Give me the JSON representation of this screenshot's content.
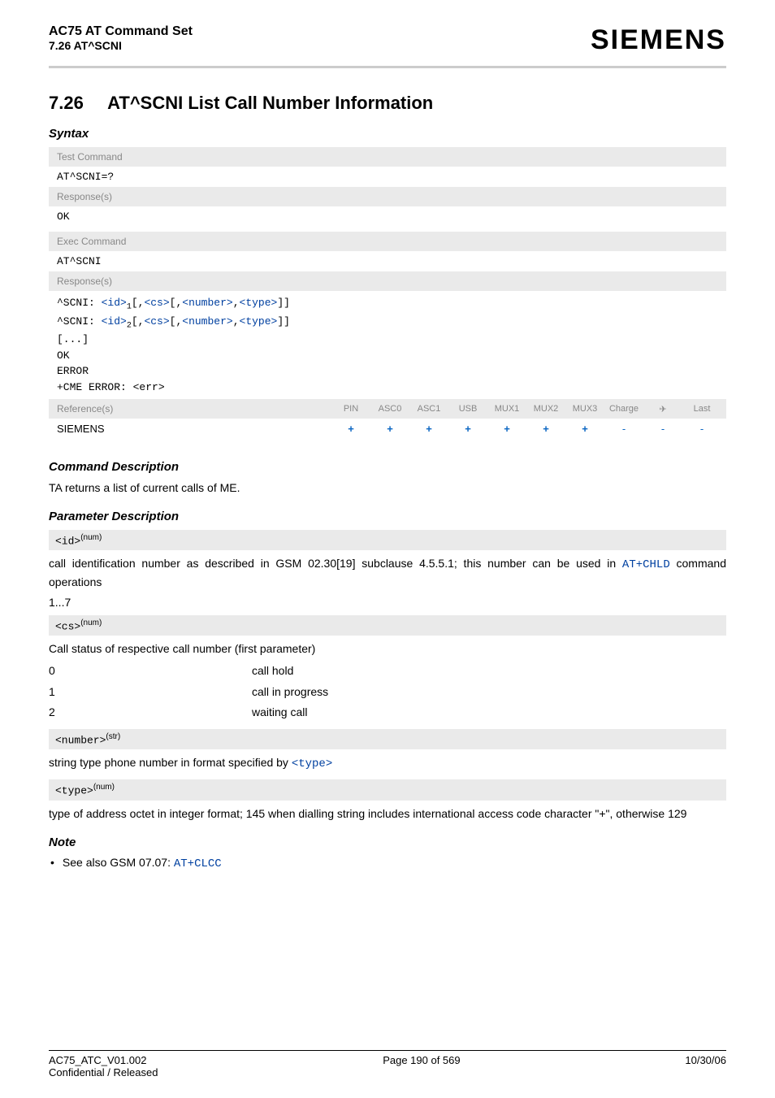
{
  "header": {
    "title": "AC75 AT Command Set",
    "subtitle": "7.26 AT^SCNI",
    "logo": "SIEMENS"
  },
  "section": {
    "number": "7.26",
    "title": "AT^SCNI   List Call Number Information"
  },
  "syntax": {
    "heading": "Syntax",
    "test_label": "Test Command",
    "test_cmd": "AT^SCNI=?",
    "resp_label": "Response(s)",
    "ok": "OK",
    "exec_label": "Exec Command",
    "exec_cmd": "AT^SCNI",
    "scni_prefix": "^SCNI: ",
    "id_label": "<id>",
    "cs_label": "<cs>",
    "number_label": "<number>",
    "type_label": "<type>",
    "ellipsis": "[...]",
    "error": "ERROR",
    "cme_err": "+CME ERROR: <err>"
  },
  "refs": {
    "label": "Reference(s)",
    "cols": [
      "PIN",
      "ASC0",
      "ASC1",
      "USB",
      "MUX1",
      "MUX2",
      "MUX3",
      "Charge",
      "✈",
      "Last"
    ],
    "vendor": "SIEMENS",
    "vals": [
      "+",
      "+",
      "+",
      "+",
      "+",
      "+",
      "+",
      "-",
      "-",
      "-"
    ]
  },
  "cmd_desc": {
    "heading": "Command Description",
    "text": "TA returns a list of current calls of ME."
  },
  "param_desc": {
    "heading": "Parameter Description",
    "id": {
      "tag": "<id>",
      "sup": "(num)",
      "text_pre": "call identification number as described in GSM 02.30[19] subclause 4.5.5.1; this number can be used in ",
      "link": "AT+CHLD",
      "text_post": " command operations",
      "range": "1...7"
    },
    "cs": {
      "tag": "<cs>",
      "sup": "(num)",
      "intro": "Call status of respective call number (first parameter)",
      "rows": [
        {
          "k": "0",
          "v": "call hold"
        },
        {
          "k": "1",
          "v": "call in progress"
        },
        {
          "k": "2",
          "v": "waiting call"
        }
      ]
    },
    "number": {
      "tag": "<number>",
      "sup": "(str)",
      "text_pre": "string type phone number in format specified by ",
      "link": "<type>"
    },
    "type": {
      "tag": "<type>",
      "sup": "(num)",
      "text": "type of address octet in integer format; 145 when dialling string includes international access code character \"+\", otherwise 129"
    }
  },
  "note": {
    "heading": "Note",
    "bullet_pre": "See also GSM 07.07: ",
    "link": "AT+CLCC"
  },
  "footer": {
    "left1": "AC75_ATC_V01.002",
    "left2": "Confidential / Released",
    "center": "Page 190 of 569",
    "right": "10/30/06"
  }
}
